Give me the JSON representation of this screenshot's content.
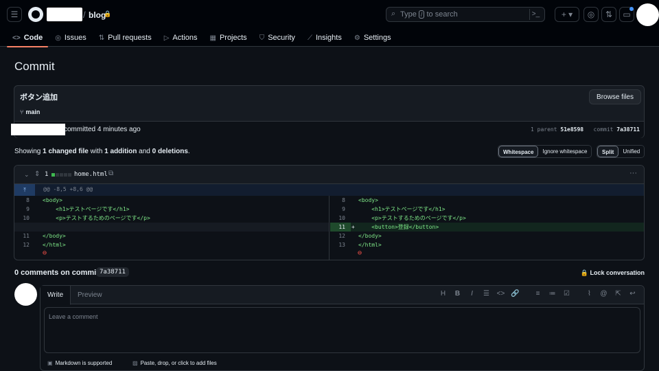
{
  "header": {
    "repo_name": "blog",
    "search_placeholder_prefix": "Type",
    "search_key": "/",
    "search_placeholder_suffix": "to search"
  },
  "tabs": [
    {
      "label": "Code",
      "icon": "code-icon",
      "active": true
    },
    {
      "label": "Issues",
      "icon": "issue-opened-icon"
    },
    {
      "label": "Pull requests",
      "icon": "git-pull-request-icon"
    },
    {
      "label": "Actions",
      "icon": "play-icon"
    },
    {
      "label": "Projects",
      "icon": "table-icon"
    },
    {
      "label": "Security",
      "icon": "shield-icon"
    },
    {
      "label": "Insights",
      "icon": "graph-icon"
    },
    {
      "label": "Settings",
      "icon": "gear-icon"
    }
  ],
  "page": {
    "title": "Commit"
  },
  "commit": {
    "message": "ボタン追加",
    "branch": "main",
    "browse_label": "Browse files",
    "committed_text": "committed 4 minutes ago",
    "parent_label": "1 parent",
    "parent_sha": "51e8598",
    "commit_label": "commit",
    "commit_sha": "7a38711"
  },
  "summary": {
    "showing": "Showing ",
    "changed": "1 changed file",
    "with": " with ",
    "additions": "1 addition",
    "and": " and ",
    "deletions": "0 deletions",
    "end": "."
  },
  "view_options": {
    "whitespace": [
      "Whitespace",
      "Ignore whitespace"
    ],
    "layout": [
      "Split",
      "Unified"
    ]
  },
  "diff": {
    "count": "1",
    "filename": "home.html",
    "hunk_header": "@@ -8,5 +8,6 @@",
    "left": [
      {
        "ln": "8",
        "code": "<body>"
      },
      {
        "ln": "9",
        "code": "    <h1>テストページです</h1>"
      },
      {
        "ln": "10",
        "code": "    <p>テストするためのページです</p>"
      },
      {
        "ln": "",
        "code": ""
      },
      {
        "ln": "11",
        "code": "</body>"
      },
      {
        "ln": "12",
        "code": "</html>"
      }
    ],
    "right": [
      {
        "ln": "8",
        "code": "<body>"
      },
      {
        "ln": "9",
        "code": "    <h1>テストページです</h1>"
      },
      {
        "ln": "10",
        "code": "    <p>テストするためのページです</p>"
      },
      {
        "ln": "11",
        "code": "    <button>登録</button>",
        "marker": "+"
      },
      {
        "ln": "12",
        "code": "</body>"
      },
      {
        "ln": "13",
        "code": "</html>"
      }
    ]
  },
  "comments": {
    "title": "0 comments on commit",
    "sha": "7a38711",
    "lock_label": "Lock conversation",
    "tab_write": "Write",
    "tab_preview": "Preview",
    "placeholder": "Leave a comment",
    "markdown_note": "Markdown is supported",
    "attach_note": "Paste, drop, or click to add files"
  }
}
